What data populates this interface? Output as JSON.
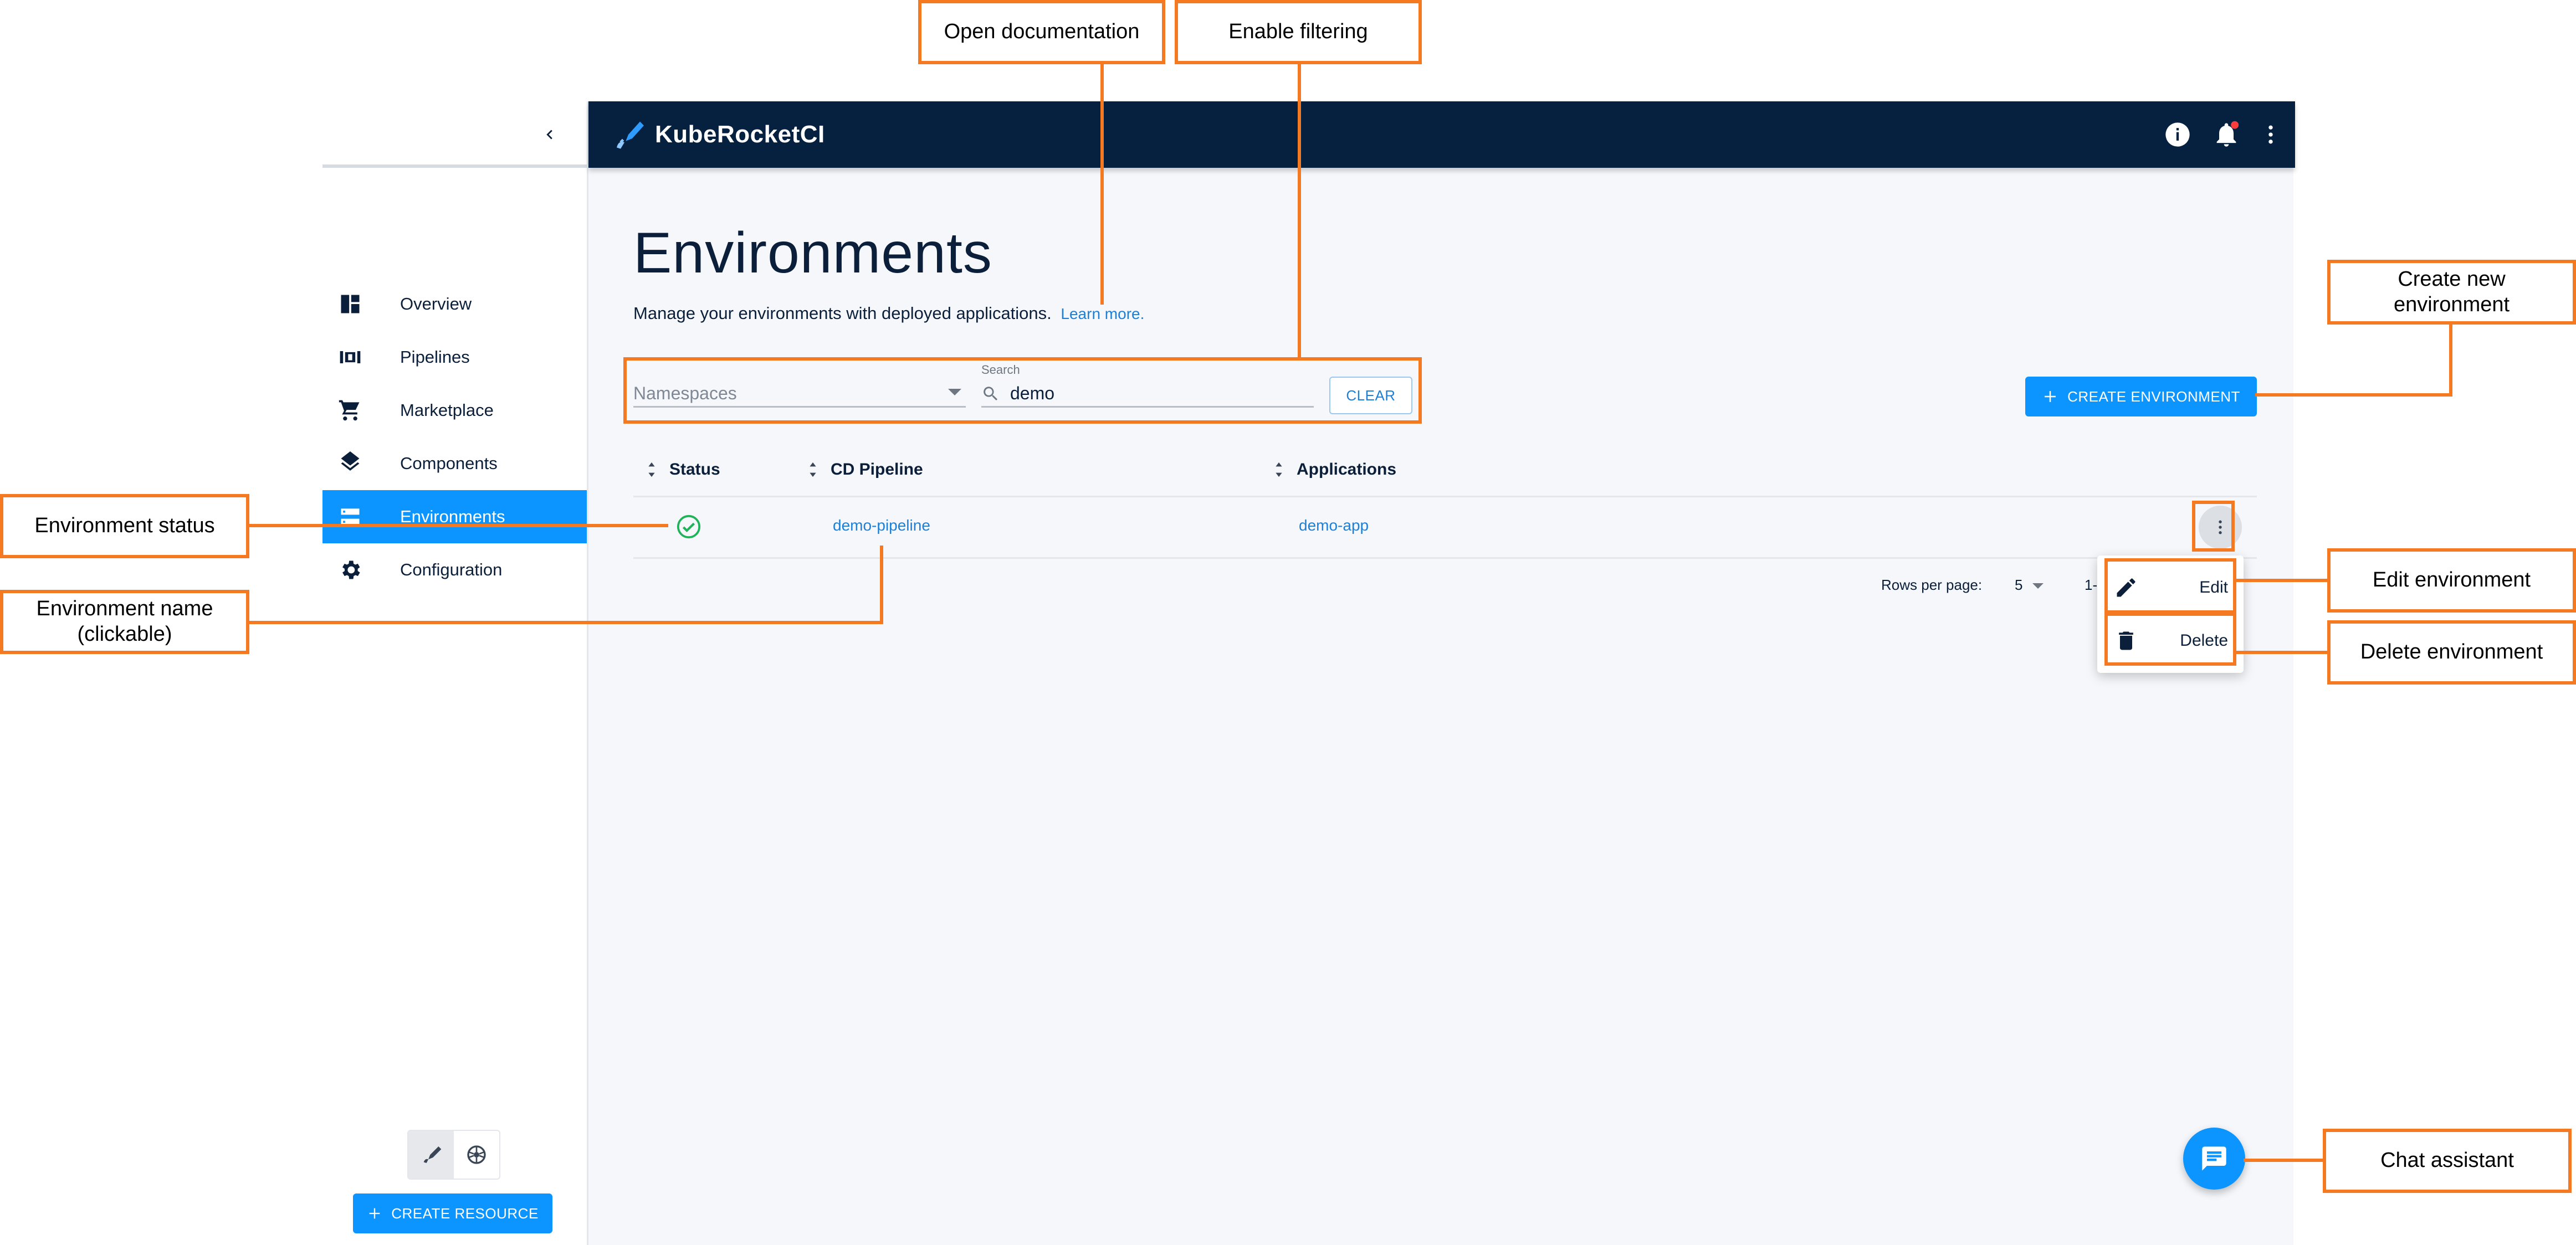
{
  "colors": {
    "accent": "#0c94ff",
    "topbar": "#06213f",
    "callout": "#f47920",
    "link": "#1d7fd6",
    "success": "#20b35a"
  },
  "sidebar": {
    "collapse_icon": "chevron-left-icon",
    "items": [
      {
        "label": "Overview",
        "icon": "dashboard-icon"
      },
      {
        "label": "Pipelines",
        "icon": "pipelines-icon"
      },
      {
        "label": "Marketplace",
        "icon": "cart-icon"
      },
      {
        "label": "Components",
        "icon": "layers-icon"
      },
      {
        "label": "Environments",
        "icon": "storage-icon",
        "active": true
      },
      {
        "label": "Configuration",
        "icon": "gear-icon"
      }
    ],
    "create_resource": "CREATE RESOURCE"
  },
  "topbar": {
    "brand": "KubeRocketCI",
    "icons": [
      "info-icon",
      "bell-icon",
      "more-vertical-icon"
    ]
  },
  "page": {
    "title": "Environments",
    "description": "Manage your environments with deployed applications.",
    "learn_more": "Learn more."
  },
  "filters": {
    "namespaces_placeholder": "Namespaces",
    "search_label": "Search",
    "search_value": "demo",
    "clear": "CLEAR"
  },
  "create_environment": "CREATE ENVIRONMENT",
  "table": {
    "columns": [
      "Status",
      "CD Pipeline",
      "Applications"
    ],
    "rows": [
      {
        "status": "success",
        "cd_pipeline": "demo-pipeline",
        "applications": "demo-app"
      }
    ]
  },
  "pagination": {
    "rows_per_page_label": "Rows per page:",
    "rows_per_page": "5",
    "range": "1-"
  },
  "row_menu": {
    "edit": "Edit",
    "delete": "Delete"
  },
  "callouts": {
    "open_documentation": "Open documentation",
    "enable_filtering": "Enable filtering",
    "create_new_environment": "Create new environment",
    "environment_status": "Environment status",
    "environment_name": "Environment name (clickable)",
    "edit_environment": "Edit environment",
    "delete_environment": "Delete environment",
    "chat_assistant": "Chat assistant"
  }
}
